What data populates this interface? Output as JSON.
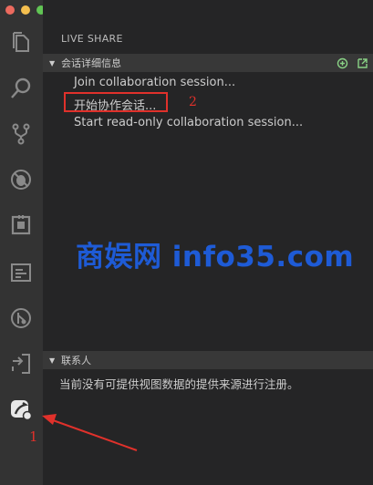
{
  "window": {
    "traffic_lights": [
      "#ec6a5e",
      "#f4bf4f",
      "#61c554"
    ]
  },
  "activity_bar": {
    "items": [
      {
        "icon": "files-icon"
      },
      {
        "icon": "search-icon"
      },
      {
        "icon": "source-control-icon"
      },
      {
        "icon": "debug-icon"
      },
      {
        "icon": "extensions-icon"
      },
      {
        "icon": "explorer-view-icon"
      },
      {
        "icon": "gitlens-icon"
      },
      {
        "icon": "live-share-arrow-icon"
      },
      {
        "icon": "live-share-icon"
      }
    ]
  },
  "sidebar": {
    "title": "LIVE SHARE",
    "session_section": {
      "title": "会话详细信息",
      "items": [
        "Join collaboration session...",
        "开始协作会话...",
        "Start read-only collaboration session..."
      ]
    },
    "contacts_section": {
      "title": "联系人",
      "empty_message": "当前没有可提供视图数据的提供来源进行注册。"
    }
  },
  "annotations": {
    "label_1": "1",
    "label_2": "2",
    "color": "#e0312b"
  },
  "watermark": "商娱网 info35.com"
}
